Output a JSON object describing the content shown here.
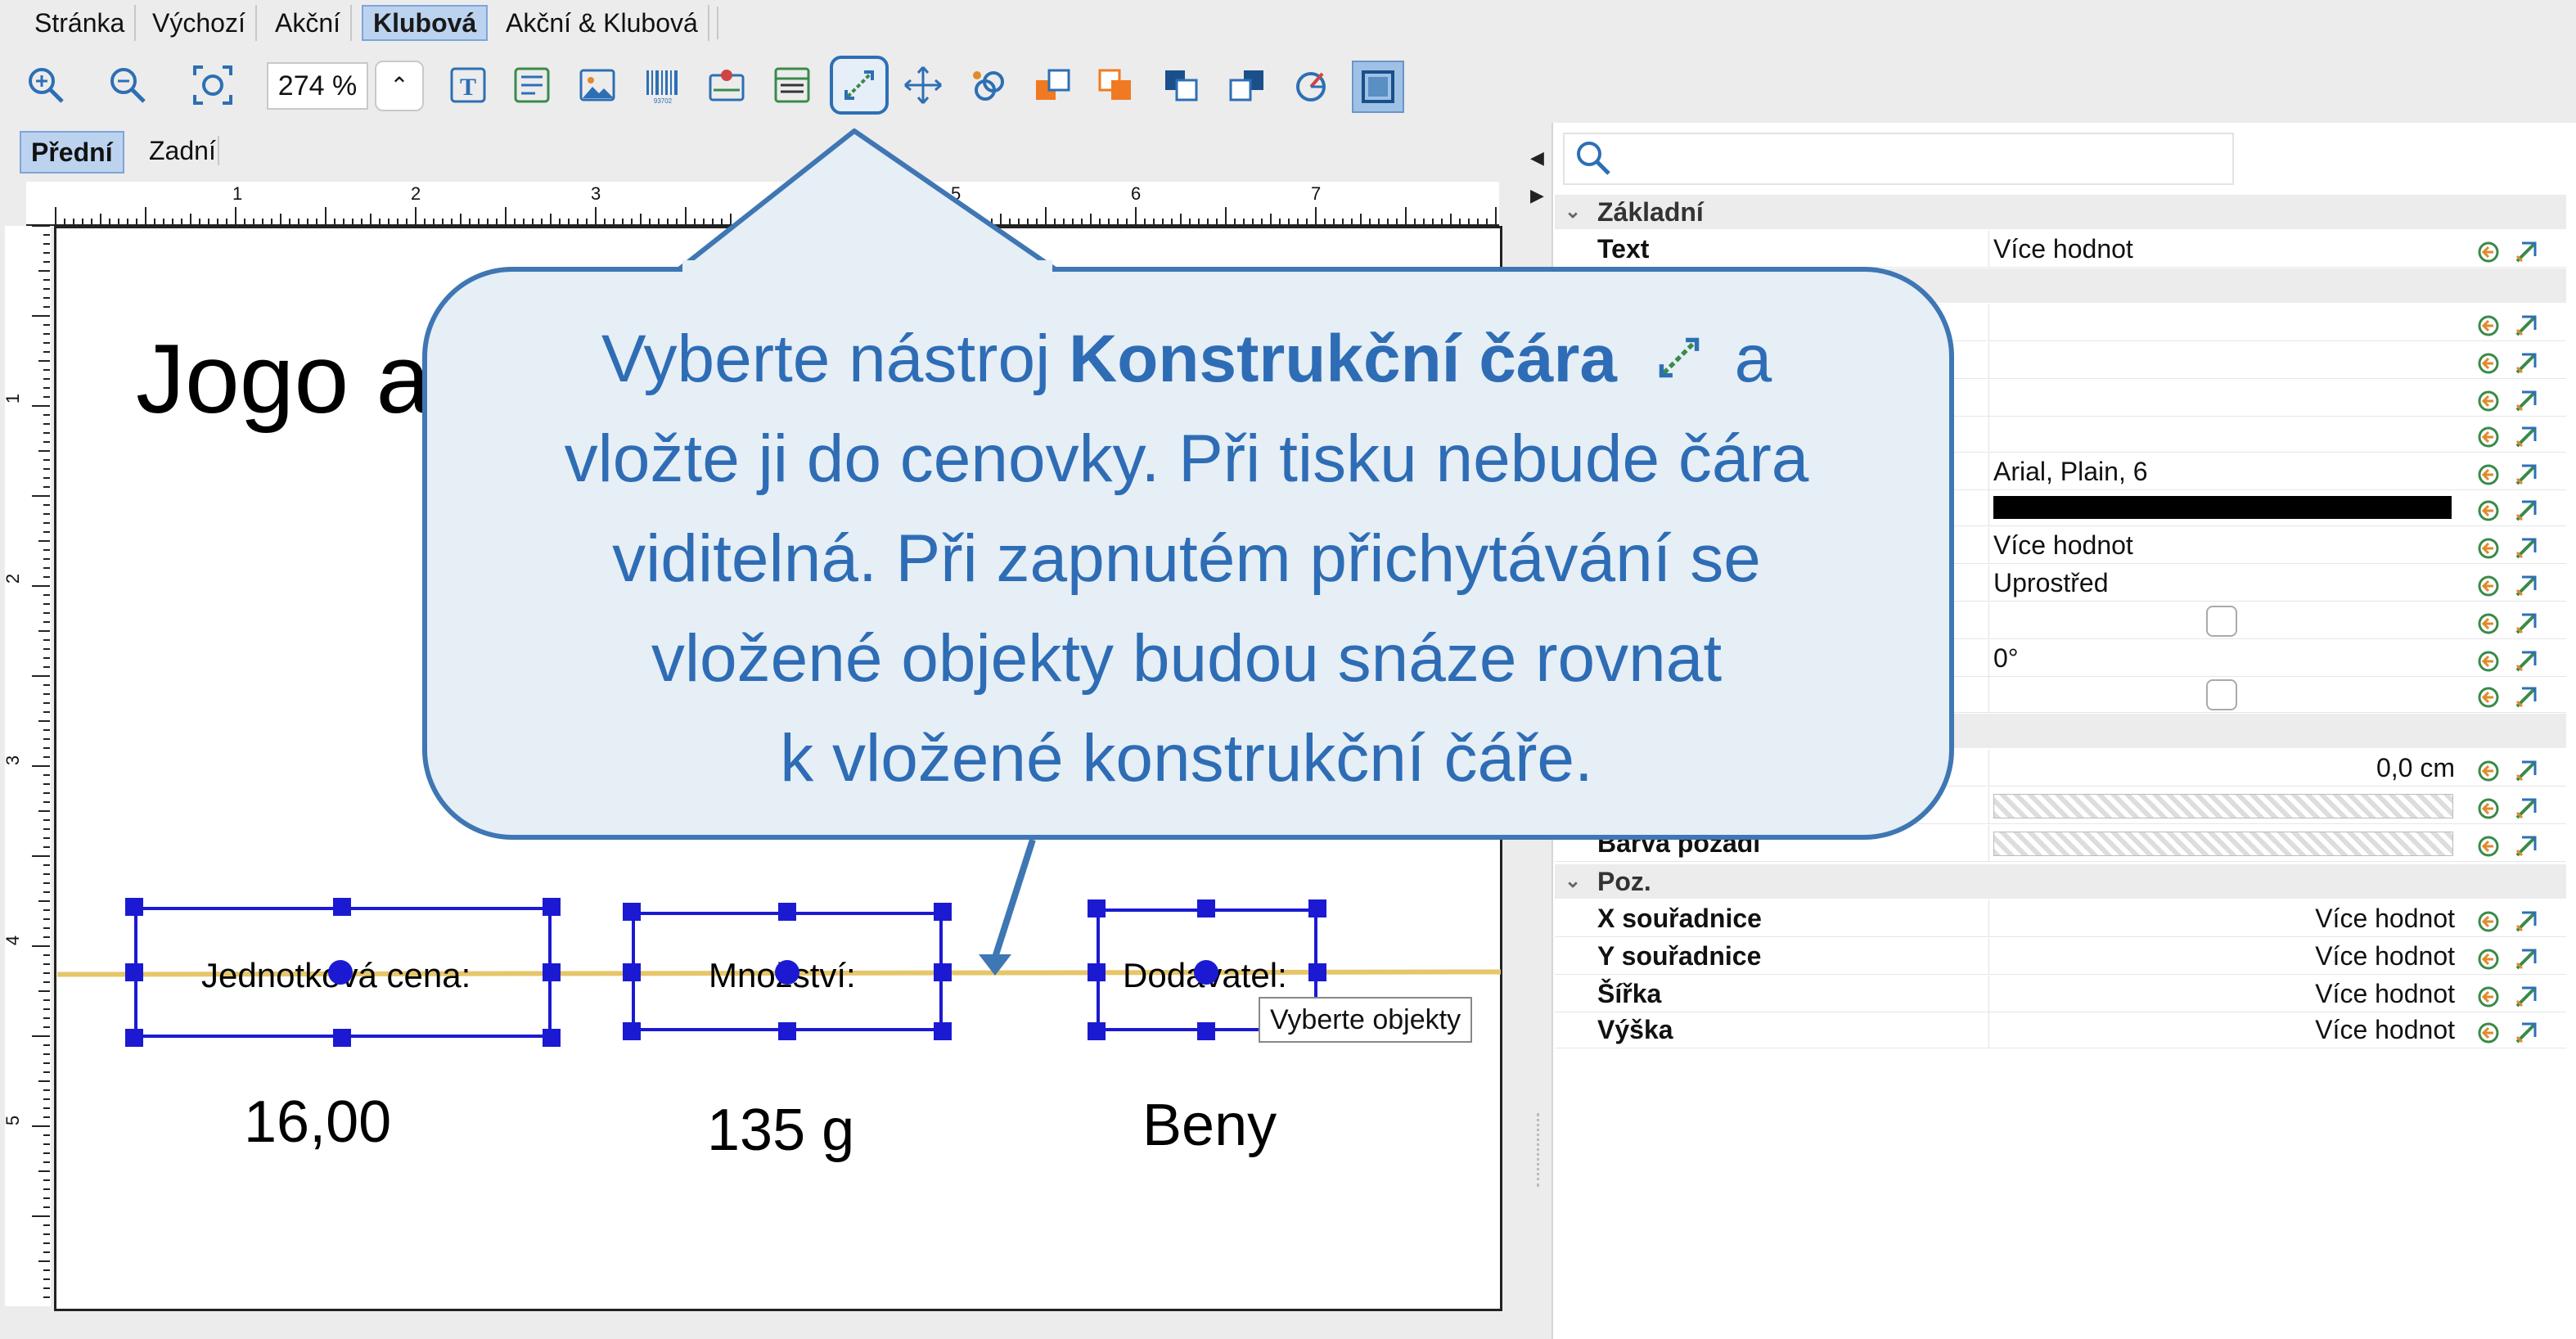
{
  "menu_tabs": [
    {
      "label": "Stránka",
      "active": false
    },
    {
      "label": "Výchozí",
      "active": false
    },
    {
      "label": "Akční",
      "active": false
    },
    {
      "label": "Klubová",
      "active": true
    },
    {
      "label": "Akční & Klubová",
      "active": false
    }
  ],
  "toolbar": {
    "zoom_value": "274 %",
    "icons": [
      "zoom-in-icon",
      "zoom-out-icon",
      "zoom-fit-icon",
      "text-tool-icon",
      "rich-text-icon",
      "image-icon",
      "barcode-icon",
      "map-icon",
      "table-icon",
      "construction-line-icon",
      "move-icon",
      "link-icon",
      "bring-front-icon",
      "bring-forward-icon",
      "send-backward-icon",
      "send-back-icon",
      "rotate-icon",
      "frame-icon"
    ]
  },
  "side_tabs": [
    {
      "label": "Přední",
      "active": true
    },
    {
      "label": "Zadní",
      "active": false
    }
  ],
  "rulers": {
    "horizontal": [
      "1",
      "2",
      "3",
      "5",
      "6",
      "7"
    ],
    "vertical": [
      "1",
      "2",
      "3",
      "4",
      "5"
    ]
  },
  "page": {
    "title": "Jogo a",
    "label_price": "Jednotková cena:",
    "label_qty": "Množství:",
    "label_supplier": "Dodavatel:",
    "value_price": "16,00",
    "value_qty": "135 g",
    "value_supplier": "Beny",
    "tooltip": "Vyberte objekty"
  },
  "callout": {
    "part1": "Vyberte nástroj ",
    "tool_name": "Konstrukční čára",
    "part2": " a",
    "line2": "vložte ji do cenovky. Při tisku nebude čára",
    "line3": "viditelná. Při zapnutém přichytávání se",
    "line4": "vložené objekty budou snáze rovnat",
    "line5": "k vložené konstrukční čáře."
  },
  "properties": {
    "search_placeholder": "",
    "section_basic": "Základní",
    "rows_basic": [
      {
        "label": "Text",
        "value": "Více hodnot"
      }
    ],
    "font_value": "Arial, Plain, 6",
    "text_value": "Více hodnot",
    "align_value": "Uprostřed",
    "rotation_value": "0°",
    "offset_value": "0,0 cm",
    "bg_label": "Barva pozadí",
    "section_pos": "Poz.",
    "rows_pos": [
      {
        "label": "X souřadnice",
        "value": "Více hodnot"
      },
      {
        "label": "Y souřadnice",
        "value": "Více hodnot"
      },
      {
        "label": "Šířka",
        "value": "Více hodnot"
      },
      {
        "label": "Výška",
        "value": "Více hodnot"
      }
    ]
  },
  "colors": {
    "accent": "#3f76b4",
    "callout_bg": "#e6eef6",
    "selection": "#1b1ad2",
    "construction_line": "#e6c66a"
  }
}
